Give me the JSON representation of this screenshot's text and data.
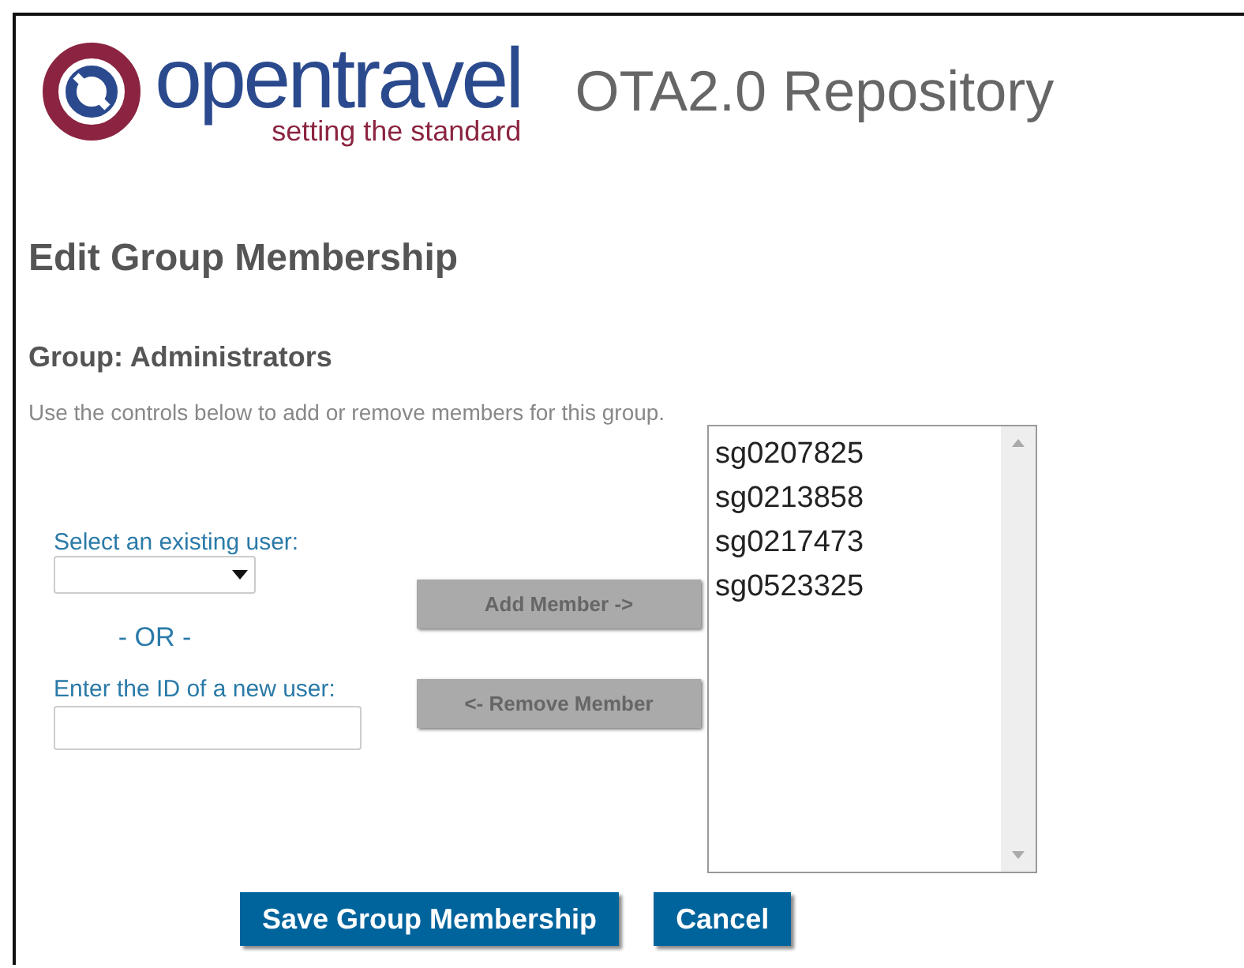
{
  "header": {
    "logo_word": "opentravel",
    "logo_tagline": "setting the standard",
    "title": "OTA2.0 Repository"
  },
  "page_title": "Edit Group Membership",
  "group_heading": "Group: Administrators",
  "description": "Use the controls below to add or remove members for this group.",
  "existing_user": {
    "label": "Select an existing user:"
  },
  "separator": "- OR -",
  "new_user": {
    "label": "Enter the ID of a new user:"
  },
  "move_buttons": [
    {
      "label": "Add Member ->",
      "disabled": true
    },
    {
      "label": "<- Remove Member",
      "disabled": true
    }
  ],
  "members": [
    "sg0207825",
    "sg0213858",
    "sg0217473",
    "sg0523325"
  ],
  "buttons": [
    {
      "label": "Save Group Membership"
    },
    {
      "label": "Cancel"
    }
  ]
}
